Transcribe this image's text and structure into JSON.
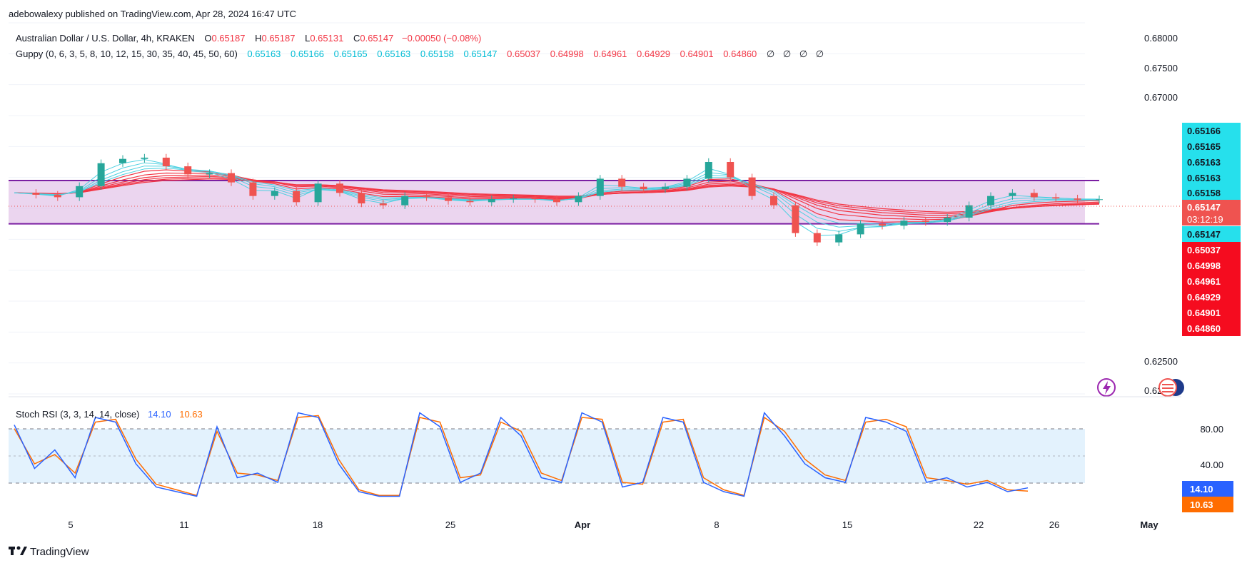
{
  "header": {
    "publisher_line": "adebowalexy published on TradingView.com, Apr 28, 2024 16:47 UTC"
  },
  "footer": {
    "brand": "TradingView"
  },
  "legend": {
    "symbol": "Australian Dollar / U.S. Dollar, 4h, KRAKEN",
    "o_label": "O",
    "o_value": "0.65187",
    "h_label": "H",
    "h_value": "0.65187",
    "l_label": "L",
    "l_value": "0.65131",
    "c_label": "C",
    "c_value": "0.65147",
    "change": "−0.00050 (−0.08%)",
    "guppy_label": "Guppy (0, 6, 3, 5, 8, 10, 12, 15, 30, 35, 40, 45, 50, 60)",
    "guppy_fast_values": [
      "0.65163",
      "0.65166",
      "0.65165",
      "0.65163",
      "0.65158",
      "0.65147"
    ],
    "guppy_slow_values": [
      "0.65037",
      "0.64998",
      "0.64961",
      "0.64929",
      "0.64901",
      "0.64860"
    ],
    "guppy_empty": [
      "∅",
      "∅",
      "∅",
      "∅"
    ],
    "rsi_label": "Stoch RSI (3, 3, 14, 14, close)",
    "rsi_k": "14.10",
    "rsi_d": "10.63"
  },
  "colors": {
    "fast": "#4dd0e1",
    "slow": "#f23645",
    "zone_fill": "#e1bee7",
    "zone_line": "#7b1fa2",
    "rsi_k": "#2962ff",
    "rsi_d": "#ff6d00",
    "rsi_band": "#e3f2fd",
    "up_candle": "#26a69a",
    "down_candle": "#ef5350"
  },
  "price_axis": {
    "ticks": [
      "0.68000",
      "0.67500",
      "0.67000",
      "0.62500",
      "0.62000"
    ],
    "badges_fast": [
      "0.65166",
      "0.65165",
      "0.65163",
      "0.65163",
      "0.65158"
    ],
    "last_price": "0.65147",
    "countdown": "03:12:19",
    "badge_fast_low": "0.65147",
    "badges_slow": [
      "0.65037",
      "0.64998",
      "0.64961",
      "0.64929",
      "0.64901",
      "0.64860"
    ]
  },
  "rsi_axis": {
    "ticks": [
      "80.00",
      "40.00"
    ],
    "k_badge": "14.10",
    "d_badge": "10.63"
  },
  "time_axis": {
    "labels": [
      "5",
      "11",
      "18",
      "25",
      "Apr",
      "8",
      "15",
      "22",
      "26",
      "May"
    ]
  },
  "chart_data": {
    "type": "line",
    "title": "Australian Dollar / U.S. Dollar, 4h, KRAKEN",
    "xlabel": "",
    "ylabel": "",
    "ylim": [
      0.62,
      0.68
    ],
    "zone": [
      0.6475,
      0.6545
    ],
    "last_close": 0.65147,
    "x_ticks": [
      "5",
      "11",
      "18",
      "25",
      "Apr",
      "8",
      "15",
      "22",
      "26",
      "May"
    ],
    "series": [
      {
        "name": "Close (approx.)",
        "values": [
          0.6525,
          0.6522,
          0.6518,
          0.6536,
          0.6573,
          0.658,
          0.6582,
          0.6568,
          0.6555,
          0.6557,
          0.6542,
          0.652,
          0.6528,
          0.651,
          0.654,
          0.6525,
          0.6508,
          0.6505,
          0.652,
          0.6518,
          0.6512,
          0.651,
          0.6515,
          0.6516,
          0.6515,
          0.651,
          0.652,
          0.6548,
          0.6535,
          0.6531,
          0.6535,
          0.6548,
          0.6575,
          0.655,
          0.652,
          0.6505,
          0.646,
          0.6445,
          0.6458,
          0.6475,
          0.6472,
          0.648,
          0.6478,
          0.6485,
          0.6505,
          0.652,
          0.6525,
          0.6518,
          0.6516,
          0.6514,
          0.65147
        ]
      }
    ],
    "stoch_rsi": {
      "ylim": [
        0,
        100
      ],
      "levels": [
        80,
        20
      ],
      "k": [
        82,
        35,
        55,
        25,
        90,
        85,
        40,
        15,
        10,
        5,
        80,
        25,
        30,
        20,
        95,
        90,
        40,
        10,
        5,
        5,
        95,
        80,
        20,
        30,
        90,
        70,
        25,
        20,
        95,
        85,
        15,
        20,
        90,
        85,
        20,
        10,
        5,
        95,
        70,
        40,
        25,
        20,
        90,
        85,
        75,
        20,
        25,
        15,
        20,
        10,
        14.1
      ],
      "d": [
        78,
        40,
        50,
        30,
        85,
        88,
        45,
        18,
        12,
        6,
        75,
        30,
        28,
        22,
        90,
        92,
        45,
        12,
        6,
        6,
        90,
        85,
        25,
        28,
        85,
        75,
        30,
        22,
        90,
        88,
        20,
        18,
        85,
        88,
        25,
        12,
        6,
        90,
        75,
        45,
        28,
        22,
        85,
        88,
        80,
        25,
        22,
        18,
        22,
        12,
        10.63
      ]
    }
  }
}
